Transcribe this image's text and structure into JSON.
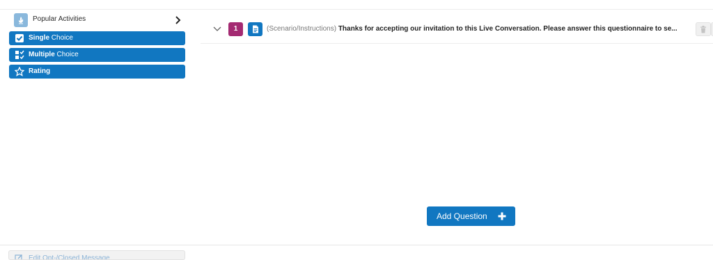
{
  "left_panel": {
    "title": "Popular Activities",
    "icon": "popular-activities-icon",
    "activities": [
      {
        "bold": "Single",
        "rest": " Choice",
        "icon": "checkbox-icon"
      },
      {
        "bold": "Multiple",
        "rest": " Choice",
        "icon": "multi-checklist-icon"
      },
      {
        "bold": "Rating",
        "rest": "",
        "icon": "star-icon"
      }
    ],
    "bottom_button": {
      "label": "Edit Opt-/Closed Message",
      "icon": "edit-icon"
    }
  },
  "question": {
    "number": "1",
    "type_icon": "document-icon",
    "prefix": "(Scenario/Instructions)",
    "text": "Thanks for accepting our invitation to this Live Conversation. Please answer this questionnaire to se..."
  },
  "add_question": {
    "label": "Add Question"
  },
  "colors": {
    "primary": "#1177c1",
    "question_number": "#a42a72",
    "popular_icon_bg": "#8ab8dc"
  }
}
